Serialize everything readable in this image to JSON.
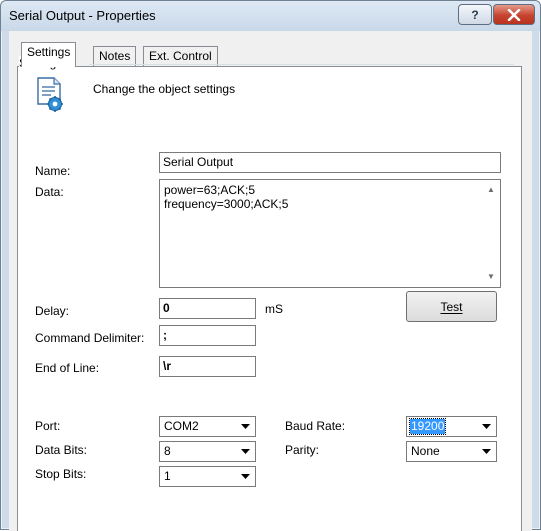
{
  "window": {
    "title": "Serial Output - Properties"
  },
  "tabs": [
    {
      "label": "Settings",
      "active": true
    },
    {
      "label": "Notes",
      "active": false
    },
    {
      "label": "Ext. Control",
      "active": false
    }
  ],
  "group": {
    "label": "Settings",
    "description": "Change the object settings",
    "icon": "settings-document-icon"
  },
  "fields": {
    "name": {
      "label": "Name:",
      "value": "Serial Output"
    },
    "data": {
      "label": "Data:",
      "lines": [
        "power=63;ACK;5",
        "frequency=3000;ACK;5"
      ]
    },
    "delay": {
      "label": "Delay:",
      "value": "0",
      "unit": "mS"
    },
    "command_delimiter": {
      "label": "Command Delimiter:",
      "value": ";"
    },
    "end_of_line": {
      "label": "End of Line:",
      "value": "\\r"
    }
  },
  "test_button": {
    "label": "Test"
  },
  "serial": {
    "port": {
      "label": "Port:",
      "value": "COM2"
    },
    "baud_rate": {
      "label": "Baud Rate:",
      "value": "19200"
    },
    "data_bits": {
      "label": "Data Bits:",
      "value": "8"
    },
    "parity": {
      "label": "Parity:",
      "value": "None"
    },
    "stop_bits": {
      "label": "Stop Bits:",
      "value": "1"
    }
  },
  "colors": {
    "title_bar": "#cfdbe9",
    "close_button": "#c64430",
    "selection": "#3399ff"
  }
}
